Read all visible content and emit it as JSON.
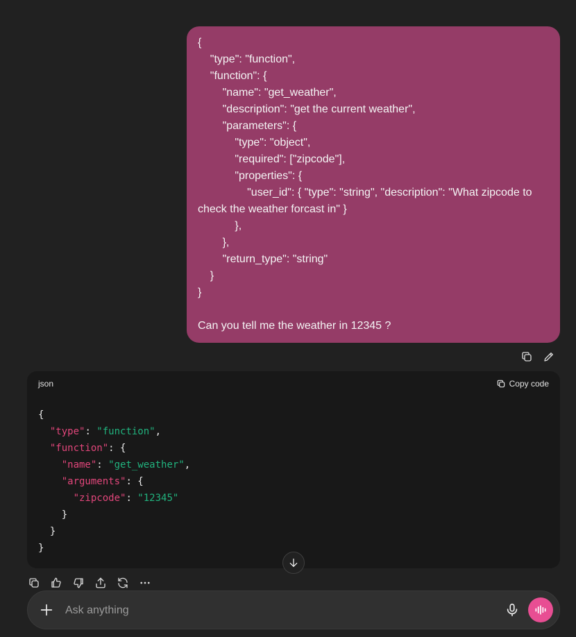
{
  "user_message": {
    "text": "{\n    \"type\": \"function\",\n    \"function\": {\n        \"name\": \"get_weather\",\n        \"description\": \"get the current weather\",\n        \"parameters\": {\n            \"type\": \"object\",\n            \"required\": [\"zipcode\"],\n            \"properties\": {\n                \"user_id\": { \"type\": \"string\", \"description\": \"What zipcode to check the weather forcast in\" }\n            },\n        },\n        \"return_type\": \"string\"\n    }\n}\n\nCan you tell me the weather in 12345 ?"
  },
  "user_actions": {
    "copy_icon": "copy-icon",
    "edit_icon": "pencil-icon"
  },
  "code_block": {
    "language": "json",
    "copy_label": "Copy code",
    "lines": {
      "l1": "{",
      "l2_key": "\"type\"",
      "l2_sep": ": ",
      "l2_val": "\"function\"",
      "l2_end": ",",
      "l3_key": "\"function\"",
      "l3_end": ": {",
      "l4_key": "\"name\"",
      "l4_sep": ": ",
      "l4_val": "\"get_weather\"",
      "l4_end": ",",
      "l5_key": "\"arguments\"",
      "l5_end": ": {",
      "l6_key": "\"zipcode\"",
      "l6_sep": ": ",
      "l6_val": "\"12345\"",
      "l7": "}",
      "l8": "}",
      "l9": "}"
    }
  },
  "response_actions": [
    "copy-icon",
    "thumbs-up-icon",
    "thumbs-down-icon",
    "share-icon",
    "regenerate-icon",
    "more-icon"
  ],
  "composer": {
    "placeholder": "Ask anything"
  },
  "colors": {
    "user_bubble": "#953c67",
    "accent": "#e84e93",
    "json_key": "#e2467b",
    "json_string": "#21b37e"
  }
}
